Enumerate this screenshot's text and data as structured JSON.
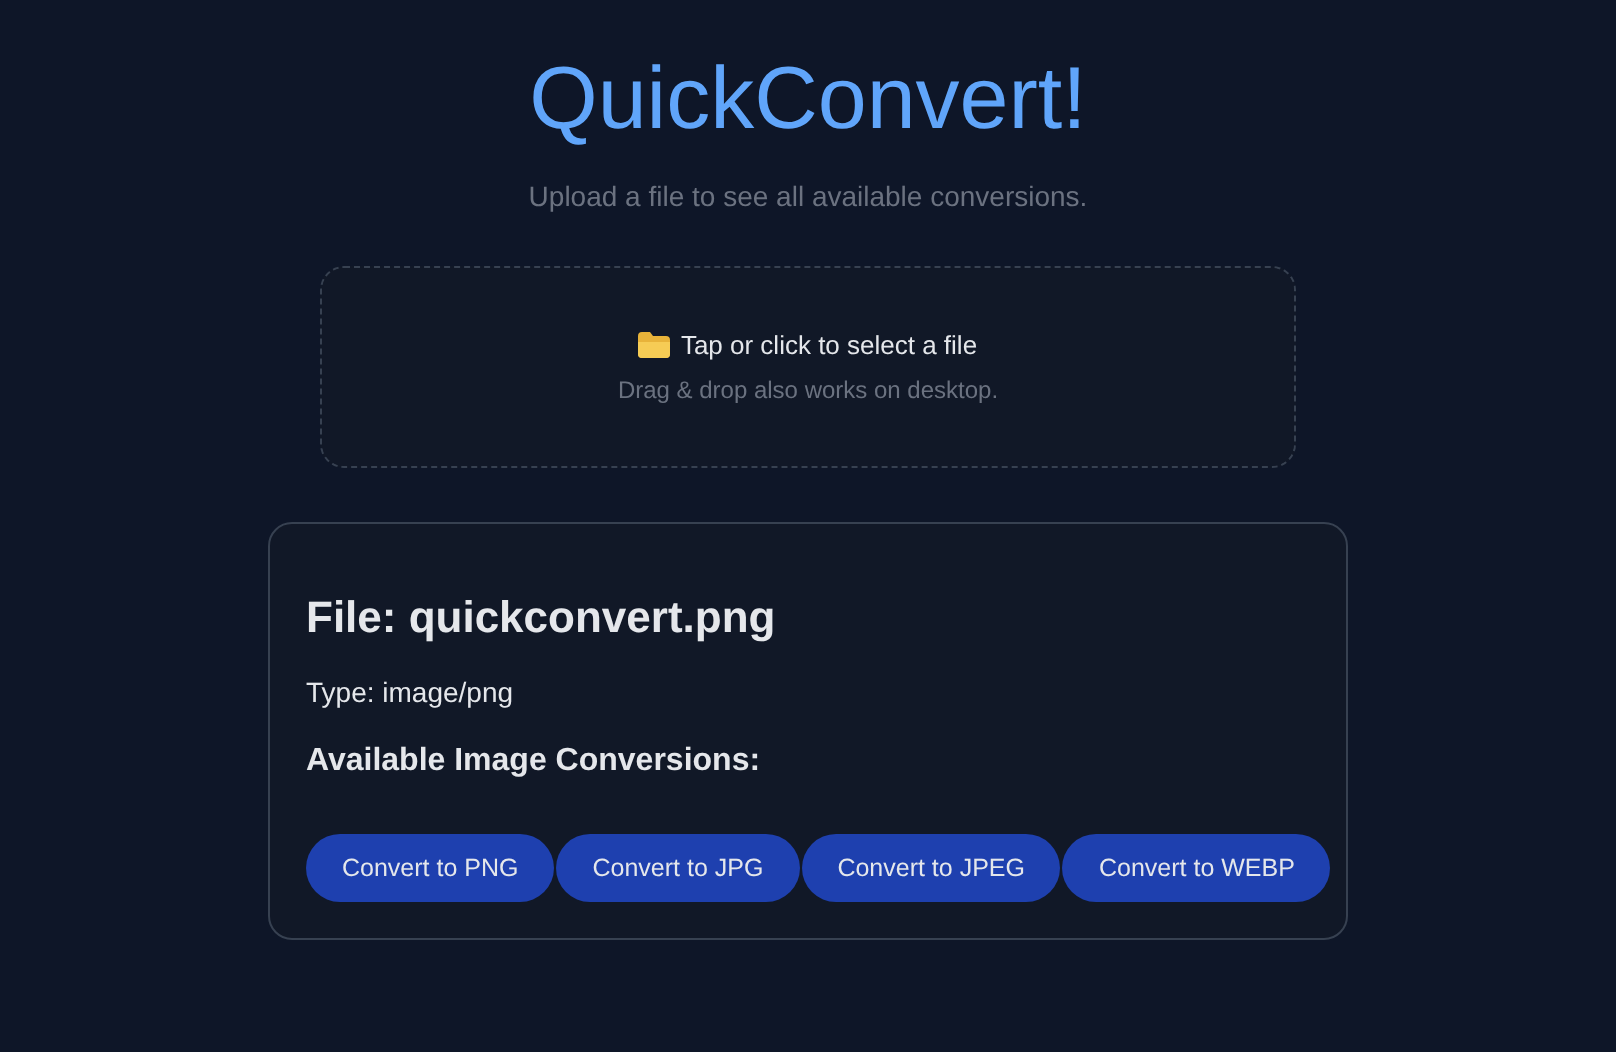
{
  "header": {
    "title": "QuickConvert!",
    "subtitle": "Upload a file to see all available conversions."
  },
  "dropzone": {
    "prompt": "Tap or click to select a file",
    "hint": "Drag & drop also works on desktop."
  },
  "file_card": {
    "title": "File: quickconvert.png",
    "type": "Type: image/png",
    "section_title": "Available Image Conversions:",
    "buttons": [
      {
        "label": "Convert to PNG"
      },
      {
        "label": "Convert to JPG"
      },
      {
        "label": "Convert to JPEG"
      },
      {
        "label": "Convert to WEBP"
      }
    ]
  }
}
